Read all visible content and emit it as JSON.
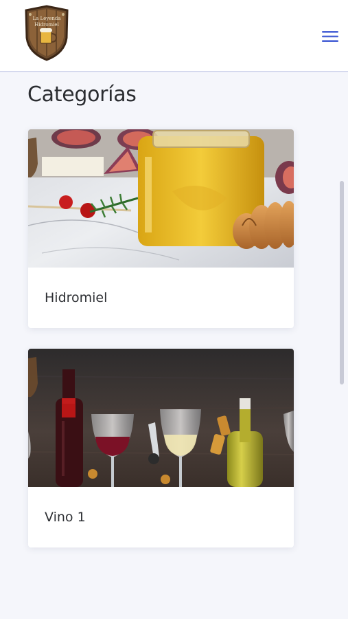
{
  "header": {
    "logo_text_top": "La Leyenda",
    "logo_text_bottom": "Hidromiel",
    "menu_icon": "hamburger-menu-icon"
  },
  "page": {
    "title": "Categorías"
  },
  "categories": [
    {
      "label": "Hidromiel",
      "image": "honey-jar-photo"
    },
    {
      "label": "Vino 1",
      "image": "wine-bottles-photo"
    }
  ],
  "colors": {
    "accent": "#4a63d6",
    "background": "#f5f6fb",
    "header_border": "#d5d9ee"
  }
}
